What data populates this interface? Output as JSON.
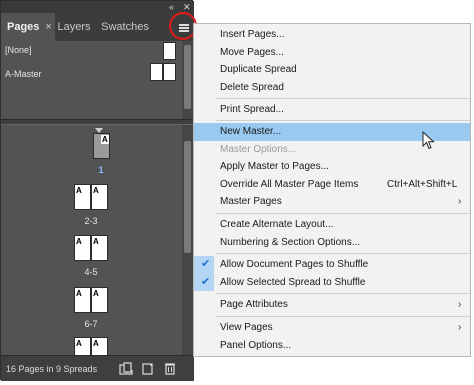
{
  "panel": {
    "collapse_glyph": "«",
    "close_glyph": "✕",
    "tabs": [
      {
        "label": "Pages",
        "close": "×"
      },
      {
        "label": "Layers"
      },
      {
        "label": "Swatches"
      }
    ],
    "masters": [
      {
        "label": "[None]"
      },
      {
        "label": "A-Master"
      }
    ],
    "page_letter": "A",
    "spreads": [
      "1",
      "2-3",
      "4-5",
      "6-7"
    ],
    "status": "16 Pages in 9 Spreads",
    "icons": [
      "panel-menu-icon",
      "edit-page-size-icon",
      "new-page-icon",
      "delete-page-icon"
    ]
  },
  "menu": {
    "items": [
      {
        "label": "Insert Pages..."
      },
      {
        "label": "Move Pages..."
      },
      {
        "label": "Duplicate Spread"
      },
      {
        "label": "Delete Spread"
      },
      {
        "sep": true
      },
      {
        "label": "Print Spread..."
      },
      {
        "sep": true
      },
      {
        "label": "New Master...",
        "highlight": true
      },
      {
        "label": "Master Options...",
        "disabled": true
      },
      {
        "label": "Apply Master to Pages..."
      },
      {
        "label": "Override All Master Page Items",
        "shortcut": "Ctrl+Alt+Shift+L"
      },
      {
        "label": "Master Pages",
        "submenu": true
      },
      {
        "sep": true
      },
      {
        "label": "Create Alternate Layout..."
      },
      {
        "label": "Numbering & Section Options..."
      },
      {
        "sep": true
      },
      {
        "label": "Allow Document Pages to Shuffle",
        "checked": true
      },
      {
        "label": "Allow Selected Spread to Shuffle",
        "checked": true
      },
      {
        "sep": true
      },
      {
        "label": "Page Attributes",
        "submenu": true
      },
      {
        "sep": true
      },
      {
        "label": "View Pages",
        "submenu": true
      },
      {
        "label": "Panel Options..."
      }
    ],
    "check_glyph": "✔",
    "arrow_glyph": "›"
  },
  "colors": {
    "panel_bg": "#535353",
    "menu_bg": "#f2f2f2",
    "highlight": "#99c9f0",
    "check_bg": "#b4d6f4",
    "annotation_ring": "#e11a1a"
  }
}
